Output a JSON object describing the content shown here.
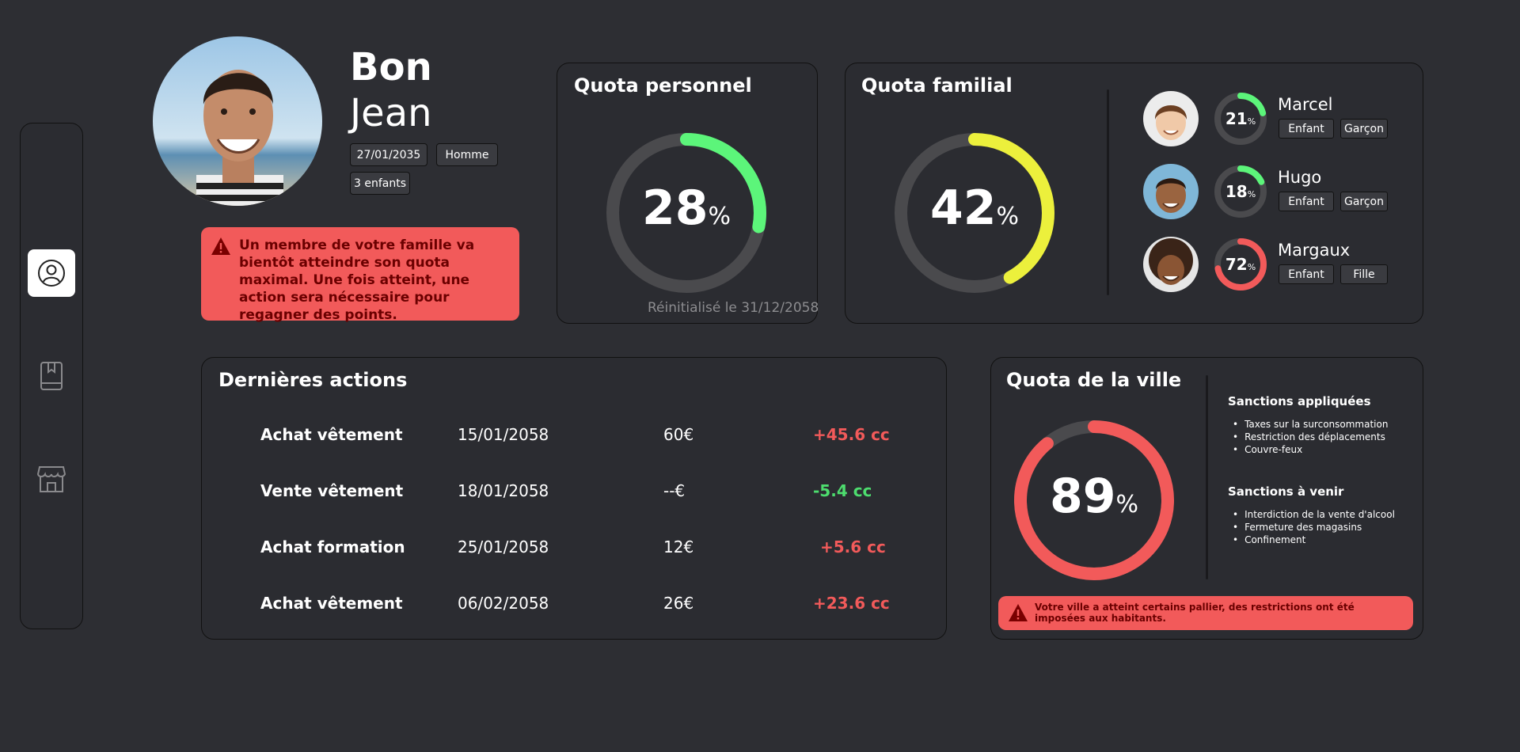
{
  "sidebar": {
    "items": [
      {
        "icon": "user-circle-icon",
        "active": true
      },
      {
        "icon": "bookmark-book-icon",
        "active": false
      },
      {
        "icon": "store-icon",
        "active": false
      }
    ]
  },
  "profile": {
    "greeting": "Bon",
    "name": "Jean",
    "birthdate": "27/01/2035",
    "gender": "Homme",
    "children": "3 enfants",
    "alert": "Un membre de votre famille va bientôt atteindre son quota maximal. Une fois atteint, une action sera nécessaire pour regagner des points."
  },
  "personal_quota": {
    "title": "Quota personnel",
    "value": 28,
    "unit": "%",
    "color": "#5cf57a",
    "reset": "Réinitialisé le 31/12/2058"
  },
  "family_quota": {
    "title": "Quota familial",
    "value": 42,
    "unit": "%",
    "color": "#ecf03c",
    "members": [
      {
        "name": "Marcel",
        "value": 21,
        "unit": "%",
        "color": "#5cf57a",
        "role": "Enfant",
        "gender": "Garçon"
      },
      {
        "name": "Hugo",
        "value": 18,
        "unit": "%",
        "color": "#5cf57a",
        "role": "Enfant",
        "gender": "Garçon"
      },
      {
        "name": "Margaux",
        "value": 72,
        "unit": "%",
        "color": "#f25a5a",
        "role": "Enfant",
        "gender": "Fille"
      }
    ]
  },
  "actions": {
    "title": "Dernières actions",
    "rows": [
      {
        "label": "Achat vêtement",
        "date": "15/01/2058",
        "amount": "60€",
        "cc": "+45.6 cc",
        "status": "positive"
      },
      {
        "label": "Vente vêtement",
        "date": "18/01/2058",
        "amount": "--€",
        "cc": "-5.4 cc",
        "status": "negative"
      },
      {
        "label": "Achat formation",
        "date": "25/01/2058",
        "amount": "12€",
        "cc": "+5.6 cc",
        "status": "positive"
      },
      {
        "label": "Achat vêtement",
        "date": "06/02/2058",
        "amount": "26€",
        "cc": "+23.6 cc",
        "status": "positive"
      }
    ]
  },
  "city_quota": {
    "title": "Quota de la ville",
    "value": 89,
    "unit": "%",
    "color": "#f25a5a",
    "applied_title": "Sanctions appliquées",
    "applied": [
      "Taxes sur la surconsommation",
      "Restriction des déplacements",
      "Couvre-feux"
    ],
    "upcoming_title": "Sanctions à venir",
    "upcoming": [
      "Interdiction de la vente d'alcool",
      "Fermeture des magasins",
      "Confinement"
    ],
    "alert": "Votre ville a atteint certains pallier, des restrictions ont été imposées aux habitants."
  },
  "colors": {
    "background": "#2d2e33",
    "card": "#2b2c31",
    "track": "#4a4a4d",
    "alert": "#f25a5a",
    "alert_text": "#6b0000",
    "positive": "#f25a5a",
    "negative": "#4ddd6e"
  }
}
